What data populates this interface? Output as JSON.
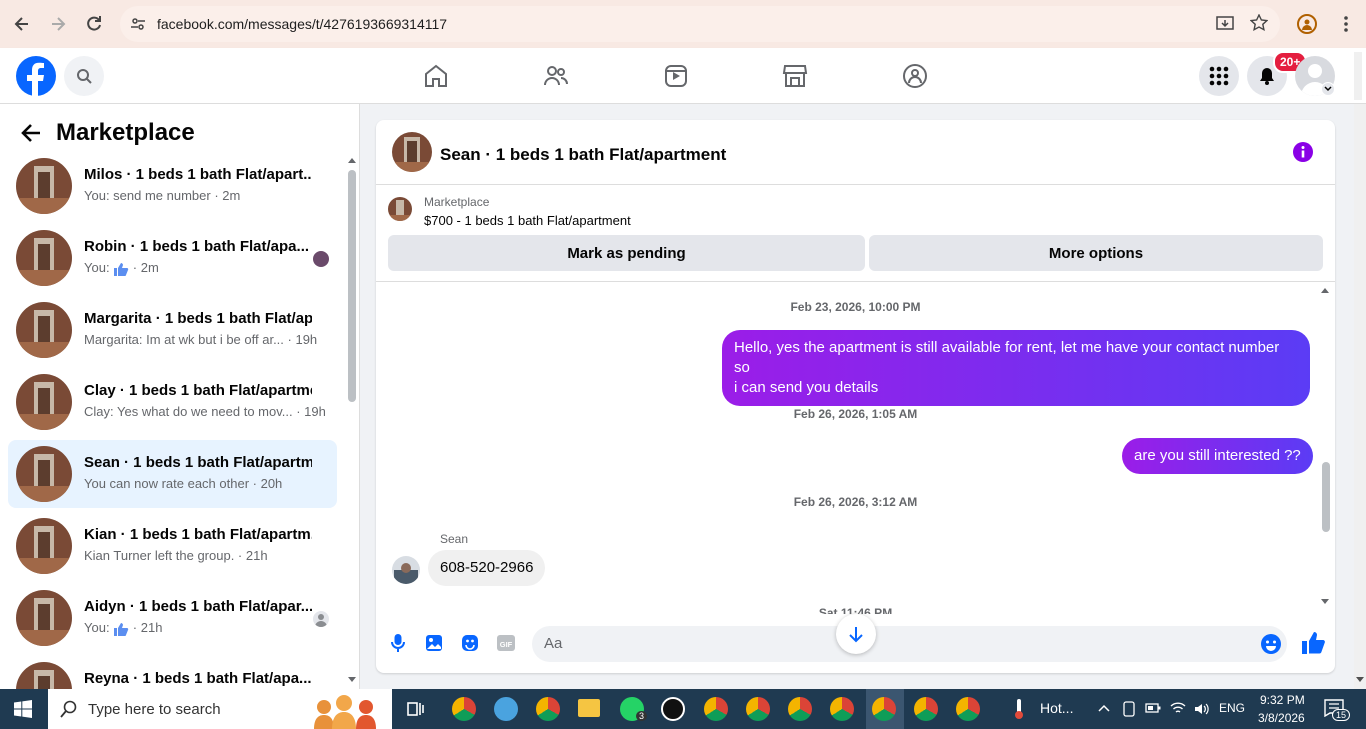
{
  "browser": {
    "url": "facebook.com/messages/t/4276193669314117"
  },
  "header": {
    "notifications_badge": "20+"
  },
  "sidebar": {
    "title": "Marketplace",
    "conversations": [
      {
        "name": "Milos · 1 beds 1 bath Flat/apart...",
        "preview": "You: send me number",
        "time": "2m"
      },
      {
        "name": "Robin · 1 beds 1 bath Flat/apa...",
        "preview": "You: ",
        "time": "2m"
      },
      {
        "name": "Margarita · 1 beds 1 bath Flat/ap...",
        "preview": "Margarita: Im at wk but i be off ar...",
        "time": "19h"
      },
      {
        "name": "Clay · 1 beds 1 bath Flat/apartme...",
        "preview": "Clay: Yes what do we need to mov...",
        "time": "19h"
      },
      {
        "name": "Sean · 1 beds 1 bath Flat/apartm...",
        "preview": "You can now rate each other",
        "time": "20h"
      },
      {
        "name": "Kian · 1 beds 1 bath Flat/apartm...",
        "preview": "Kian Turner left the group.",
        "time": "21h"
      },
      {
        "name": "Aidyn · 1 beds 1 bath Flat/apar...",
        "preview": "You: ",
        "time": "21h"
      },
      {
        "name": "Reyna · 1 beds 1 bath Flat/apa...",
        "preview": "",
        "time": ""
      }
    ]
  },
  "chat": {
    "title": "Sean · 1 beds 1 bath Flat/apartment",
    "listing_source": "Marketplace",
    "listing_title": "$700 - 1 beds 1 bath Flat/apartment",
    "mark_pending_label": "Mark as pending",
    "more_options_label": "More options",
    "messages": [
      {
        "timestamp": "Feb 23, 2026, 10:00 PM",
        "text_line1": "Hello, yes the apartment is still available for rent, let me have your contact number so",
        "text_line2": "i can send you details"
      },
      {
        "timestamp": "Feb 26, 2026, 1:05 AM",
        "text": "are you still interested ??"
      },
      {
        "timestamp": "Feb 26, 2026, 3:12 AM",
        "sender": "Sean",
        "text": "608-520-2966"
      },
      {
        "timestamp": "Sat 11:46 PM"
      }
    ],
    "composer_placeholder": "Aa"
  },
  "taskbar": {
    "search_placeholder": "Type here to search",
    "whatsapp_count": "3",
    "weather": "Hot...",
    "language": "ENG",
    "time": "9:32 PM",
    "date": "3/8/2026",
    "notification_count": "15"
  },
  "colors": {
    "facebook_blue": "#0866ff",
    "message_gradient_start": "#9b1de8",
    "message_gradient_end": "#5b3cf5",
    "badge_red": "#e41e3f",
    "selected_row": "#e7f3ff",
    "taskbar": "#1f3a51"
  }
}
